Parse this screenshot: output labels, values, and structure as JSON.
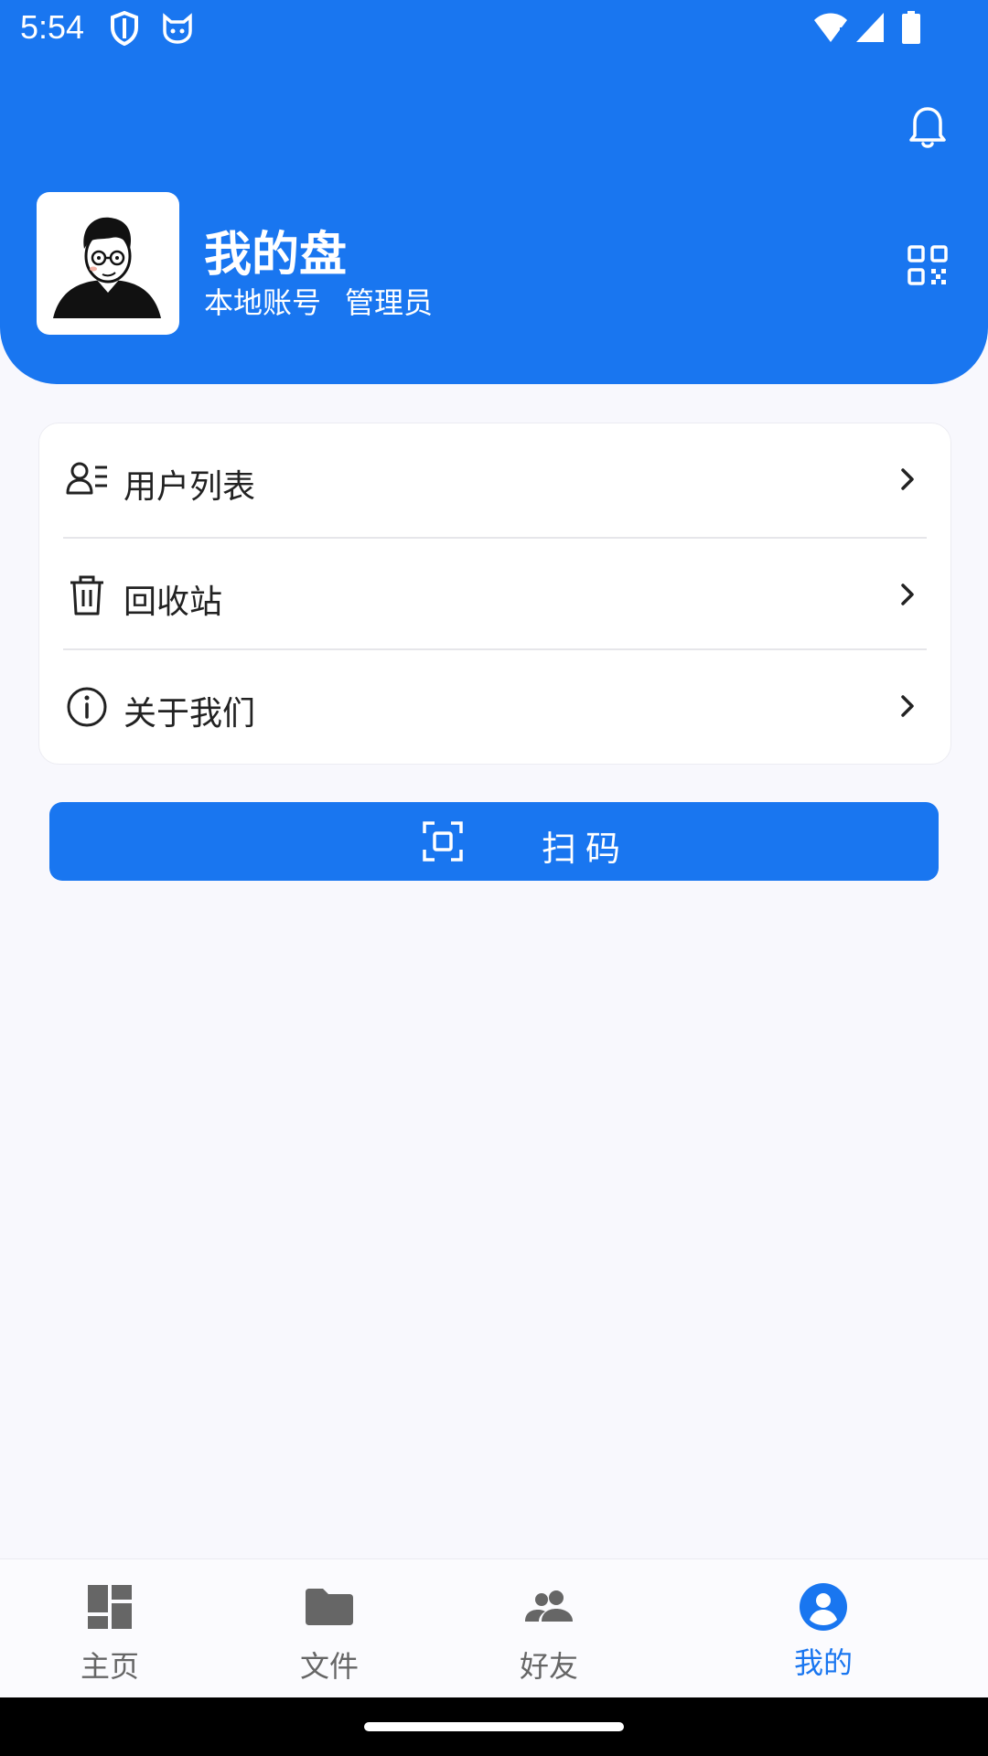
{
  "status": {
    "time": "5:54"
  },
  "profile": {
    "name": "我的盘",
    "account_type": "本地账号",
    "role": "管理员"
  },
  "menu": [
    {
      "label": "用户列表",
      "icon": "user-list-icon"
    },
    {
      "label": "回收站",
      "icon": "trash-icon"
    },
    {
      "label": "关于我们",
      "icon": "info-icon"
    }
  ],
  "scan_button": {
    "label": "扫码",
    "icon": "scan-icon"
  },
  "bottom_nav": [
    {
      "label": "主页",
      "icon": "dashboard-icon",
      "active": false
    },
    {
      "label": "文件",
      "icon": "folder-icon",
      "active": false
    },
    {
      "label": "好友",
      "icon": "people-icon",
      "active": false
    },
    {
      "label": "我的",
      "icon": "account-circle-icon",
      "active": true
    }
  ],
  "colors": {
    "primary": "#1976f0",
    "background": "#f8f8fd",
    "inactive": "#666666"
  }
}
